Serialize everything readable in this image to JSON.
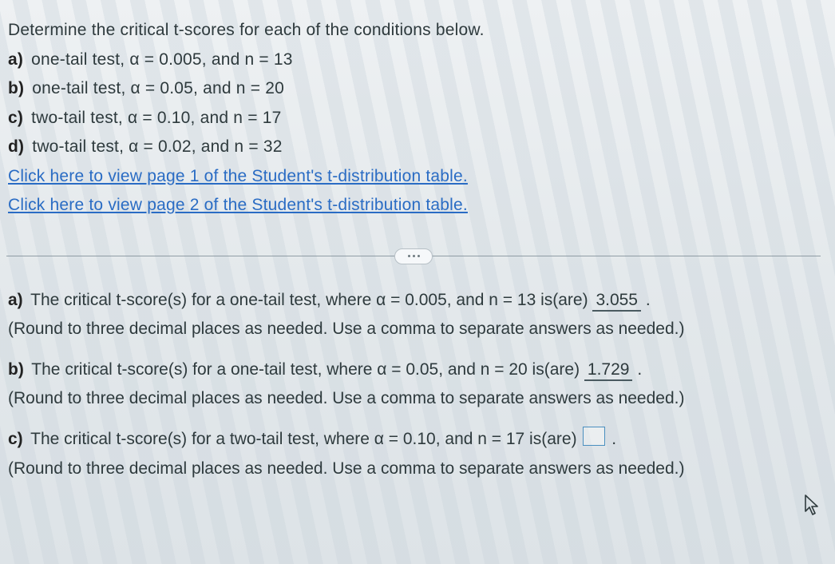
{
  "prompt": "Determine the critical t-scores for each of the conditions below.",
  "parts": {
    "a": {
      "label": "a)",
      "text": "one-tail test, α = 0.005, and n = 13"
    },
    "b": {
      "label": "b)",
      "text": "one-tail test, α = 0.05, and n = 20"
    },
    "c": {
      "label": "c)",
      "text": "two-tail test, α = 0.10, and n = 17"
    },
    "d": {
      "label": "d)",
      "text": "two-tail test, α = 0.02, and n = 32"
    }
  },
  "links": {
    "page1": "Click here to view page 1 of the Student's t-distribution table.",
    "page2": "Click here to view page 2 of the Student's t-distribution table."
  },
  "answers": {
    "a": {
      "label": "a)",
      "lead": "The critical t-score(s) for a one-tail test, where α = 0.005, and n = 13 is(are) ",
      "value": "3.055",
      "trail": " ."
    },
    "b": {
      "label": "b)",
      "lead": "The critical t-score(s) for a one-tail test, where α = 0.05, and n = 20 is(are) ",
      "value": "1.729",
      "trail": " ."
    },
    "c": {
      "label": "c)",
      "lead": "The critical t-score(s) for a two-tail test, where α = 0.10, and n = 17 is(are) ",
      "trail": " ."
    }
  },
  "hint": "(Round to three decimal places as needed. Use a comma to separate answers as needed.)"
}
